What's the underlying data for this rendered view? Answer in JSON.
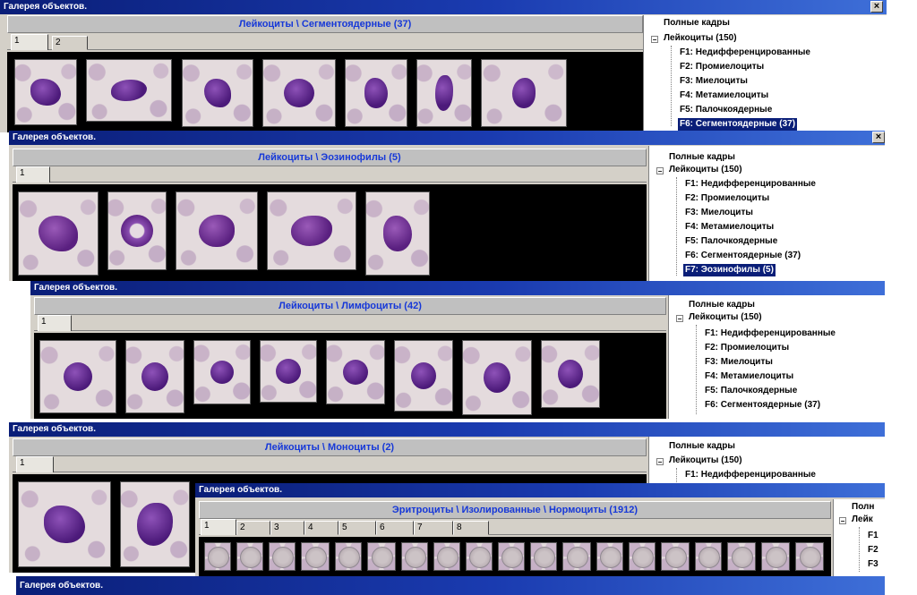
{
  "window_title": "Галерея объектов.",
  "close_glyph": "×",
  "tree_root": "Полные кадры",
  "tree_group": "Лейкоциты (150)",
  "tree_items": {
    "f1": "F1: Недифференцированные",
    "f2": "F2: Промиелоциты",
    "f3": "F3: Миелоциты",
    "f4": "F4: Метамиелоциты",
    "f5": "F5: Палочкоядерные",
    "f6": "F6: Сегментоядерные (37)",
    "f7": "F7: Эозинофилы (5)"
  },
  "trunc": {
    "w5_root": "Полн",
    "w5_group": "Лейк",
    "w5_f1": "F1",
    "w5_f2": "F2",
    "w5_f3": "F3"
  },
  "windows": {
    "w1": {
      "header": "Лейкоциты \\ Сегментоядерные (37)",
      "tabs": [
        "1",
        "2"
      ]
    },
    "w2": {
      "header": "Лейкоциты \\ Эозинофилы (5)",
      "tabs": [
        "1"
      ]
    },
    "w3": {
      "header": "Лейкоциты \\ Лимфоциты (42)",
      "tabs": [
        "1"
      ]
    },
    "w4": {
      "header": "Лейкоциты \\ Моноциты (2)",
      "tabs": [
        "1"
      ]
    },
    "w5": {
      "header": "Эритроциты \\ Изолированные \\ Нормоциты (1912)",
      "tabs": [
        "1",
        "2",
        "3",
        "4",
        "5",
        "6",
        "7",
        "8"
      ]
    }
  }
}
